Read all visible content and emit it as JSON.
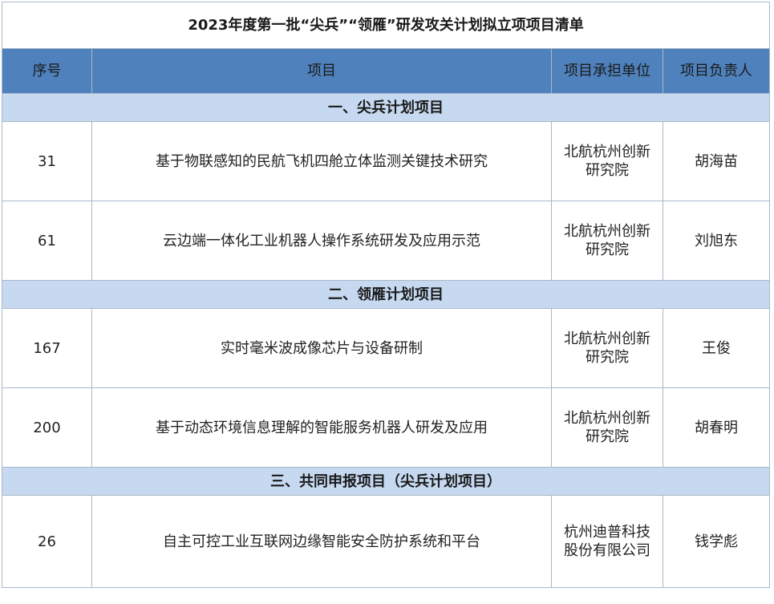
{
  "title": "2023年度第一批“尖兵”“领雁”研发攻关计划拟立项项目清单",
  "headers": {
    "no": "序号",
    "project": "项目",
    "unit": "项目承担单位",
    "leader": "项目负责人"
  },
  "sections": [
    {
      "label": "一、尖兵计划项目",
      "rows": [
        {
          "no": "31",
          "project": "基于物联感知的民航飞机四舱立体监测关键技术研究",
          "unit": "北航杭州创新研究院",
          "leader": "胡海苗"
        },
        {
          "no": "61",
          "project": "云边端一体化工业机器人操作系统研发及应用示范",
          "unit": "北航杭州创新研究院",
          "leader": "刘旭东"
        }
      ]
    },
    {
      "label": "二、领雁计划项目",
      "rows": [
        {
          "no": "167",
          "project": "实时毫米波成像芯片与设备研制",
          "unit": "北航杭州创新研究院",
          "leader": "王俊"
        },
        {
          "no": "200",
          "project": "基于动态环境信息理解的智能服务机器人研发及应用",
          "unit": "北航杭州创新研究院",
          "leader": "胡春明"
        }
      ]
    },
    {
      "label": "三、共同申报项目（尖兵计划项目）",
      "rows": [
        {
          "no": "26",
          "project": "自主可控工业互联网边缘智能安全防护系统和平台",
          "unit": "杭州迪普科技股份有限公司",
          "leader": "钱学彪"
        }
      ]
    }
  ]
}
